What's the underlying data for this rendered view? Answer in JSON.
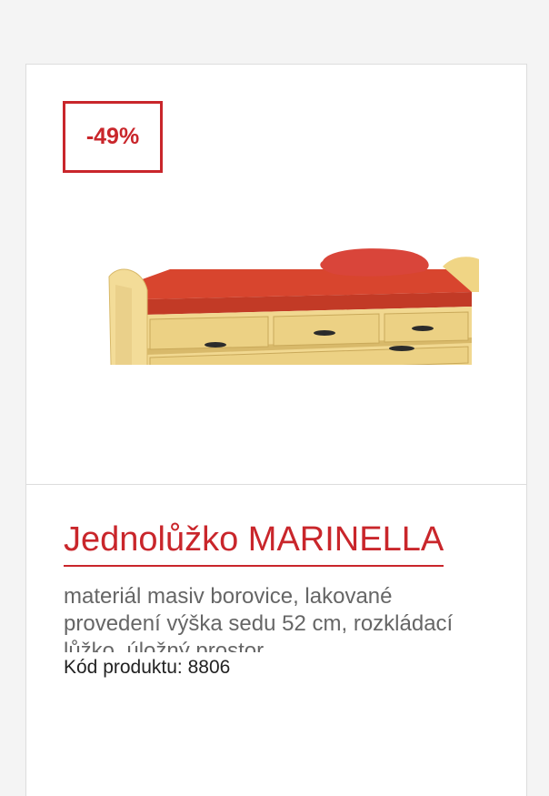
{
  "product": {
    "discount_badge": "-49%",
    "title": "Jednolůžko MARINELLA",
    "description": "materiál masiv borovice, lakované provedení výška sedu 52 cm, rozkládací lůžko, úložný prostor",
    "code_label": "Kód produktu:",
    "code_value": "8806",
    "image_icon": "bed-with-drawers",
    "colors": {
      "accent": "#c9262b",
      "background": "#f4f4f4",
      "card": "#ffffff"
    }
  }
}
